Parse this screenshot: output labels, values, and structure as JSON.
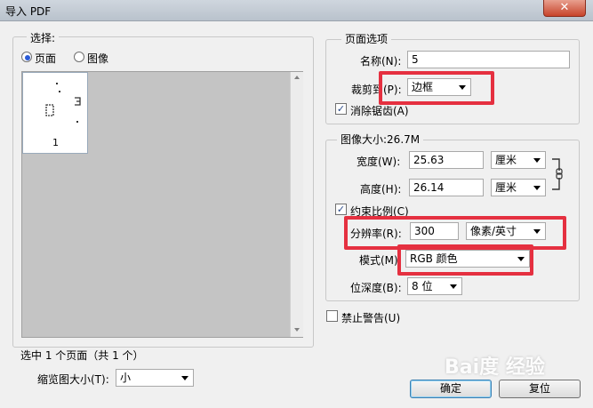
{
  "window": {
    "title": "导入 PDF",
    "close_glyph": "✕"
  },
  "select_group": {
    "legend": "选择:",
    "radio_page": "页面",
    "radio_image": "图像",
    "page_number": "1",
    "status": "选中 1 个页面（共 1 个）",
    "thumb_size_label": "缩览图大小(T):",
    "thumb_size_value": "小"
  },
  "page_options": {
    "legend": "页面选项",
    "name_label": "名称(N):",
    "name_value": "5",
    "crop_label": "裁剪到(P):",
    "crop_value": "边框",
    "antialias_label": "消除锯齿(A)",
    "antialias_checked": "✓"
  },
  "image_size": {
    "legend": "图像大小:26.7M",
    "width_label": "宽度(W):",
    "width_value": "25.63",
    "width_unit": "厘米",
    "height_label": "高度(H):",
    "height_value": "26.14",
    "height_unit": "厘米",
    "constrain_label": "约束比例(C)",
    "constrain_checked": "✓",
    "resolution_label": "分辨率(R):",
    "resolution_value": "300",
    "resolution_unit": "像素/英寸",
    "mode_label": "模式(M):",
    "mode_value": "RGB 颜色",
    "depth_label": "位深度(B):",
    "depth_value": "8 位"
  },
  "suppress_warnings_label": "禁止警告(U)",
  "buttons": {
    "ok": "确定",
    "reset": "复位"
  },
  "watermark": "Bai度 经验",
  "colors": {
    "highlight": "#e53040",
    "dialog_bg": "#f0f0f0"
  }
}
